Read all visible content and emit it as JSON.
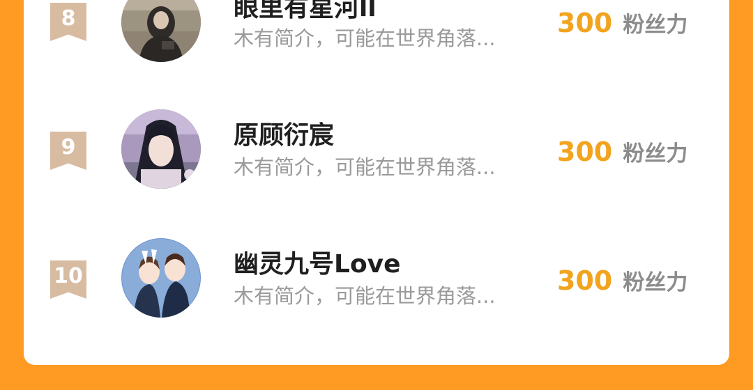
{
  "ranking": {
    "entries": [
      {
        "rank": "8",
        "name": "眼里有星河ll",
        "bio": "木有简介，可能在世界角落...",
        "score": "300",
        "unit": "粉丝力"
      },
      {
        "rank": "9",
        "name": "原顾衍宸",
        "bio": "木有简介，可能在世界角落...",
        "score": "300",
        "unit": "粉丝力"
      },
      {
        "rank": "10",
        "name": "幽灵九号Love",
        "bio": "木有简介，可能在世界角落...",
        "score": "300",
        "unit": "粉丝力"
      }
    ]
  },
  "colors": {
    "background": "#ff9a23",
    "card": "#ffffff",
    "rank_badge": "#d8bca2",
    "score": "#f2a41f",
    "unit": "#8c8c8c"
  }
}
